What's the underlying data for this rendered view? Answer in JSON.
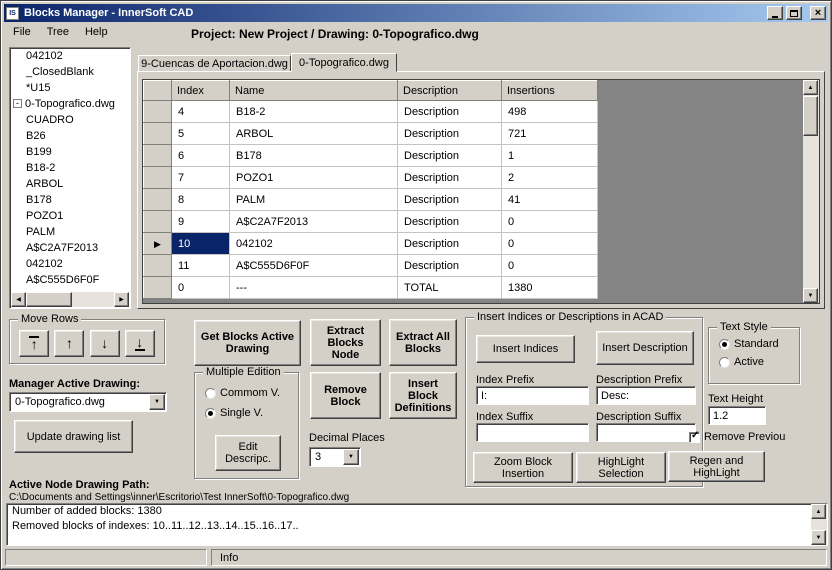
{
  "window": {
    "title": "Blocks Manager - InnerSoft CAD",
    "icon_text": "IS"
  },
  "menubar": {
    "items": [
      "File",
      "Tree",
      "Help"
    ],
    "project_label": "Project: New Project / Drawing: 0-Topografico.dwg"
  },
  "tree": {
    "items": [
      "042102",
      "_ClosedBlank",
      "*U15",
      "0-Topografico.dwg",
      "CUADRO",
      "B26",
      "B199",
      "B18-2",
      "ARBOL",
      "B178",
      "POZO1",
      "PALM",
      "A$C2A7F2013",
      "042102",
      "A$C555D6F0F"
    ]
  },
  "tabs": [
    {
      "label": "9-Cuencas de Aportacion.dwg",
      "active": false
    },
    {
      "label": "0-Topografico.dwg",
      "active": true
    }
  ],
  "grid": {
    "columns": [
      "Index",
      "Name",
      "Description",
      "Insertions"
    ],
    "rows": [
      [
        "4",
        "B18-2",
        "Description",
        "498"
      ],
      [
        "5",
        "ARBOL",
        "Description",
        "721"
      ],
      [
        "6",
        "B178",
        "Description",
        "1"
      ],
      [
        "7",
        "POZO1",
        "Description",
        "2"
      ],
      [
        "8",
        "PALM",
        "Description",
        "41"
      ],
      [
        "9",
        "A$C2A7F2013",
        "Description",
        "0"
      ],
      [
        "10",
        "042102",
        "Description",
        "0"
      ],
      [
        "11",
        "A$C555D6F0F",
        "Description",
        "0"
      ],
      [
        "0",
        "---",
        "TOTAL",
        "1380"
      ]
    ],
    "selected_row": 6
  },
  "move_rows": {
    "label": "Move Rows"
  },
  "manager": {
    "label": "Manager Active Drawing:",
    "combo_value": "0-Topografico.dwg",
    "update_button": "Update drawing list"
  },
  "buttons": {
    "get_blocks": "Get Blocks Active Drawing",
    "extract_node": "Extract Blocks Node",
    "extract_all": "Extract All Blocks",
    "remove_block": "Remove Block",
    "insert_definitions": "Insert Block Definitions",
    "edit_descripc": "Edit Descripc."
  },
  "multiple_edition": {
    "label": "Multiple Edition",
    "options": [
      "Commom V.",
      "Single V."
    ],
    "selected": "Single V."
  },
  "decimal_places": {
    "label": "Decimal Places",
    "value": "3"
  },
  "insert_group": {
    "label": "Insert Indices or Descriptions in ACAD",
    "insert_indices": "Insert Indices",
    "insert_description": "Insert Description",
    "index_prefix_label": "Index Prefix",
    "index_prefix_value": "I:",
    "description_prefix_label": "Description Prefix",
    "description_prefix_value": "Desc:",
    "index_suffix_label": "Index Suffix",
    "index_suffix_value": "",
    "description_suffix_label": "Description Suffix",
    "description_suffix_value": "",
    "zoom_block": "Zoom Block Insertion",
    "highlight_selection": "HighLight Selection",
    "regen_highlight": "Regen and HighLight"
  },
  "text_style": {
    "label": "Text Style",
    "options": [
      "Standard",
      "Active"
    ],
    "selected": "Standard"
  },
  "text_height": {
    "label": "Text Height",
    "value": "1.2"
  },
  "remove_previous": {
    "label": "Remove Previou",
    "checked": true
  },
  "path_section": {
    "label": "Active Node Drawing Path:",
    "value": "C:\\Documents and Settings\\inner\\Escritorio\\Test InnerSoft\\0-Topografico.dwg"
  },
  "log": {
    "line1": "Number of added blocks: 1380",
    "line2": "Removed blocks of indexes: 10..11..12..13..14..15..16..17.."
  },
  "statusbar": {
    "info": "Info"
  },
  "colors": {
    "titlebar_start": "#0a246a",
    "titlebar_end": "#a6caf0",
    "selection": "#0a246a"
  }
}
